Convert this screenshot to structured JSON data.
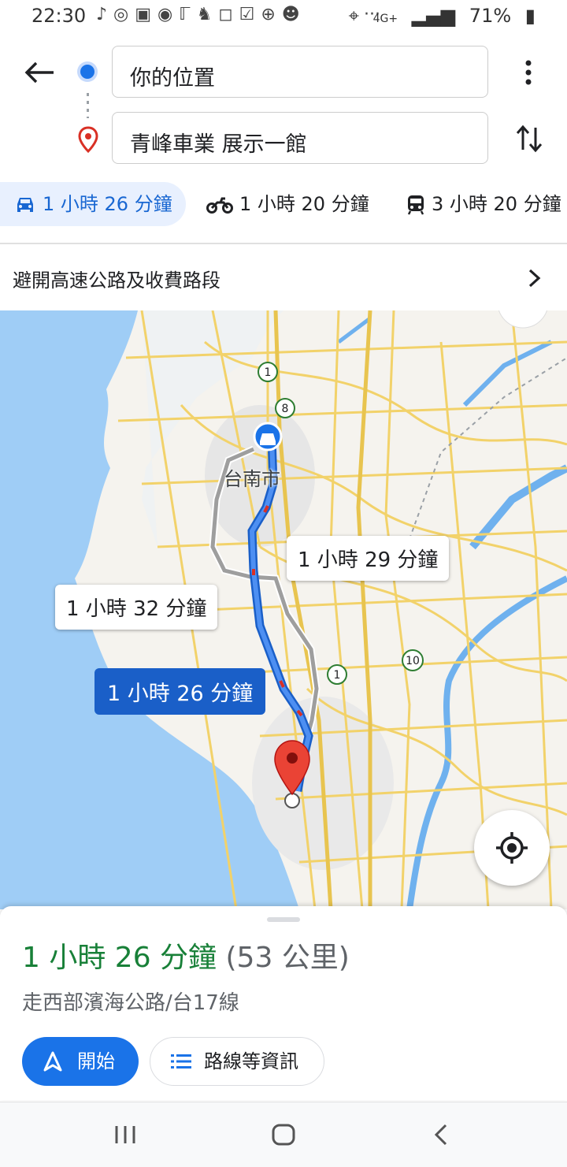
{
  "status_bar": {
    "time": "22:30",
    "notification_icons": [
      "tiktok-icon",
      "threads-icon",
      "app-icon",
      "food-icon",
      "news-icon",
      "app-icon",
      "instagram-icon",
      "check-icon",
      "search-icon",
      "app-icon"
    ],
    "more": "···",
    "network": "4G+",
    "battery": "71%"
  },
  "header": {
    "origin": "你的位置",
    "destination": "青峰車業 展示一館"
  },
  "modes": [
    {
      "icon": "car-icon",
      "label": "1 小時 26 分鐘",
      "selected": true
    },
    {
      "icon": "motorcycle-icon",
      "label": "1 小時 20 分鐘",
      "selected": false
    },
    {
      "icon": "transit-icon",
      "label": "3 小時 20 分鐘",
      "selected": false
    }
  ],
  "options": {
    "avoid": "避開高速公路及收費路段"
  },
  "map": {
    "city_label": "台南市",
    "route_labels": {
      "selected": "1 小時 26 分鐘",
      "alt1": "1 小時 29 分鐘",
      "alt2": "1 小時 32 分鐘"
    },
    "shields": [
      "1",
      "8",
      "1",
      "10"
    ]
  },
  "summary": {
    "duration": "1 小時 26 分鐘",
    "distance": "(53 公里)",
    "via": "走西部濱海公路/台17線"
  },
  "buttons": {
    "start": "開始",
    "steps": "路線等資訊"
  },
  "colors": {
    "primary": "#1a73e8",
    "summary_green": "#188038",
    "water": "#9fcdf6",
    "land": "#f5f3ee",
    "road": "#f7dc6f"
  }
}
